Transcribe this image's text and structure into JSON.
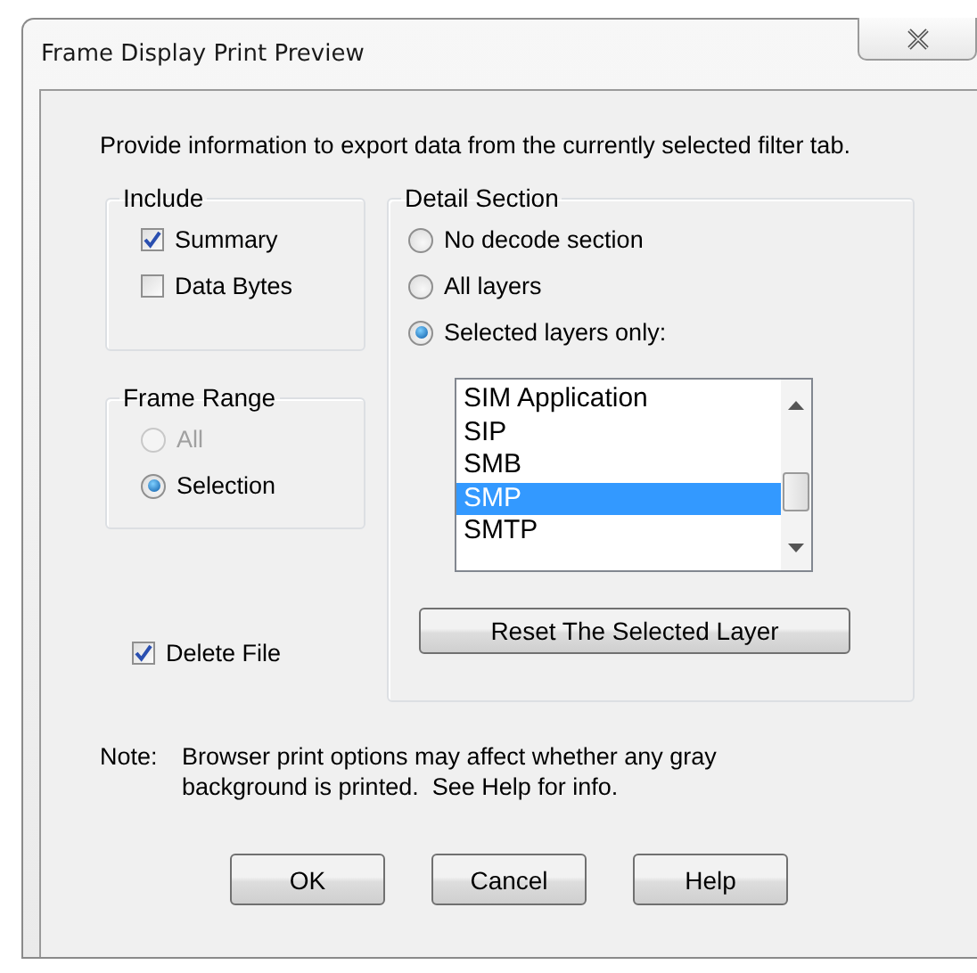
{
  "window": {
    "title": "Frame Display Print Preview"
  },
  "intro": "Provide information to export data from the currently selected filter tab.",
  "include": {
    "label": "Include",
    "options": [
      {
        "label": "Summary",
        "checked": true
      },
      {
        "label": "Data Bytes",
        "checked": false
      }
    ]
  },
  "frame_range": {
    "label": "Frame Range",
    "options": [
      {
        "label": "All",
        "selected": false,
        "disabled": true
      },
      {
        "label": "Selection",
        "selected": true,
        "disabled": false
      }
    ]
  },
  "delete_file": {
    "label": "Delete File",
    "checked": true
  },
  "detail_section": {
    "label": "Detail Section",
    "options": [
      {
        "label": "No decode section",
        "selected": false
      },
      {
        "label": "All layers",
        "selected": false
      },
      {
        "label": "Selected layers only:",
        "selected": true
      }
    ],
    "layers": [
      {
        "label": "SIM Application",
        "selected": false
      },
      {
        "label": "SIP",
        "selected": false
      },
      {
        "label": "SMB",
        "selected": false
      },
      {
        "label": "SMP",
        "selected": true
      },
      {
        "label": "SMTP",
        "selected": false
      }
    ],
    "reset_button": "Reset The Selected Layer"
  },
  "note": {
    "label": "Note:",
    "text": "Browser print options may affect whether any gray background is printed.  See Help for info."
  },
  "buttons": [
    "OK",
    "Cancel",
    "Help"
  ]
}
